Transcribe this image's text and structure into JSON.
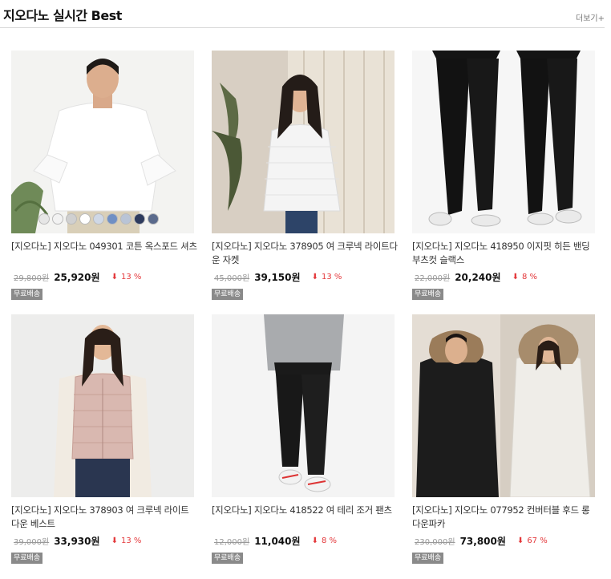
{
  "header": {
    "title": "지오다노 실시간 Best",
    "more": "더보기+"
  },
  "products": [
    {
      "name": "[지오다노] 지오다노 049301 코튼 옥스포드 셔츠",
      "original_price": "29,800원",
      "sale_price": "25,920원",
      "discount": "13 %",
      "badge": "무료배송",
      "image_icon": "white-oxford-shirt-man",
      "swatch_colors": [
        "#e6e6e6",
        "#f2f2f2",
        "#d0d0d0",
        "#ffffff",
        "#cfd8e6",
        "#6f8fc4",
        "#b9c4d6",
        "#2e3b5e",
        "#5a6a8c"
      ]
    },
    {
      "name": "[지오다노] 지오다노 378905 여 크루넥 라이트다운 자켓",
      "original_price": "45,000원",
      "sale_price": "39,150원",
      "discount": "13 %",
      "badge": "무료배송",
      "image_icon": "white-light-down-jacket-woman"
    },
    {
      "name": "[지오다노] 지오다노 418950 이지핏 히든 밴딩 부츠컷 슬랙스",
      "original_price": "22,000원",
      "sale_price": "20,240원",
      "discount": "8 %",
      "badge": "무료배송",
      "image_icon": "black-bootcut-slacks"
    },
    {
      "name": "[지오다노] 지오다노 378903 여 크루넥 라이트 다운 베스트",
      "original_price": "39,000원",
      "sale_price": "33,930원",
      "discount": "13 %",
      "badge": "무료배송",
      "image_icon": "pink-down-vest-woman"
    },
    {
      "name": "[지오다노] 지오다노 418522 여 테리 조거 팬츠",
      "original_price": "12,000원",
      "sale_price": "11,040원",
      "discount": "8 %",
      "badge": "무료배송",
      "image_icon": "black-jogger-pants"
    },
    {
      "name": "[지오다노] 지오다노 077952 컨버터블 후드 롱 다운파카",
      "original_price": "230,000원",
      "sale_price": "73,800원",
      "discount": "67 %",
      "badge": "무료배송",
      "image_icon": "long-down-parka-couple"
    }
  ],
  "colors": {
    "discount": "#e4393c",
    "badge_bg": "#8a8a8a"
  }
}
